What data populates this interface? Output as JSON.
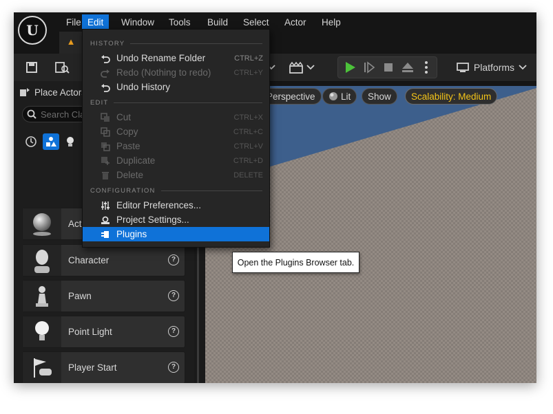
{
  "menubar": {
    "items": [
      "File",
      "Edit",
      "Window",
      "Tools",
      "Build",
      "Select",
      "Actor",
      "Help"
    ],
    "active": "Edit"
  },
  "logo": "U",
  "toolbar": {
    "platforms_label": "Platforms"
  },
  "left_panel": {
    "title": "Place Actors",
    "search_placeholder": "Search Cla",
    "actors": [
      {
        "label": "Actor",
        "icon": "sphere-icon"
      },
      {
        "label": "Character",
        "icon": "character-icon"
      },
      {
        "label": "Pawn",
        "icon": "pawn-icon"
      },
      {
        "label": "Point Light",
        "icon": "bulb-icon"
      },
      {
        "label": "Player Start",
        "icon": "flag-gamepad-icon"
      }
    ]
  },
  "viewport": {
    "chips": {
      "perspective": "Perspective",
      "lit": "Lit",
      "show": "Show",
      "scalability": "Scalability: Medium"
    },
    "colors": {
      "sky": "#3d5f8c",
      "floor": "#8f8780"
    }
  },
  "edit_menu": {
    "sections": {
      "history": "HISTORY",
      "edit": "EDIT",
      "configuration": "CONFIGURATION"
    },
    "history": [
      {
        "label": "Undo Rename Folder",
        "shortcut": "CTRL+Z",
        "enabled": true
      },
      {
        "label": "Redo (Nothing to redo)",
        "shortcut": "CTRL+Y",
        "enabled": false
      },
      {
        "label": "Undo History",
        "shortcut": "",
        "enabled": true
      }
    ],
    "edit": [
      {
        "label": "Cut",
        "shortcut": "CTRL+X",
        "enabled": false
      },
      {
        "label": "Copy",
        "shortcut": "CTRL+C",
        "enabled": false
      },
      {
        "label": "Paste",
        "shortcut": "CTRL+V",
        "enabled": false
      },
      {
        "label": "Duplicate",
        "shortcut": "CTRL+D",
        "enabled": false
      },
      {
        "label": "Delete",
        "shortcut": "DELETE",
        "enabled": false
      }
    ],
    "configuration": [
      {
        "label": "Editor Preferences...",
        "enabled": true
      },
      {
        "label": "Project Settings...",
        "enabled": true
      },
      {
        "label": "Plugins",
        "enabled": true,
        "highlighted": true
      }
    ]
  },
  "tooltip": "Open the Plugins Browser tab.",
  "accent_color": "#0f72d8"
}
